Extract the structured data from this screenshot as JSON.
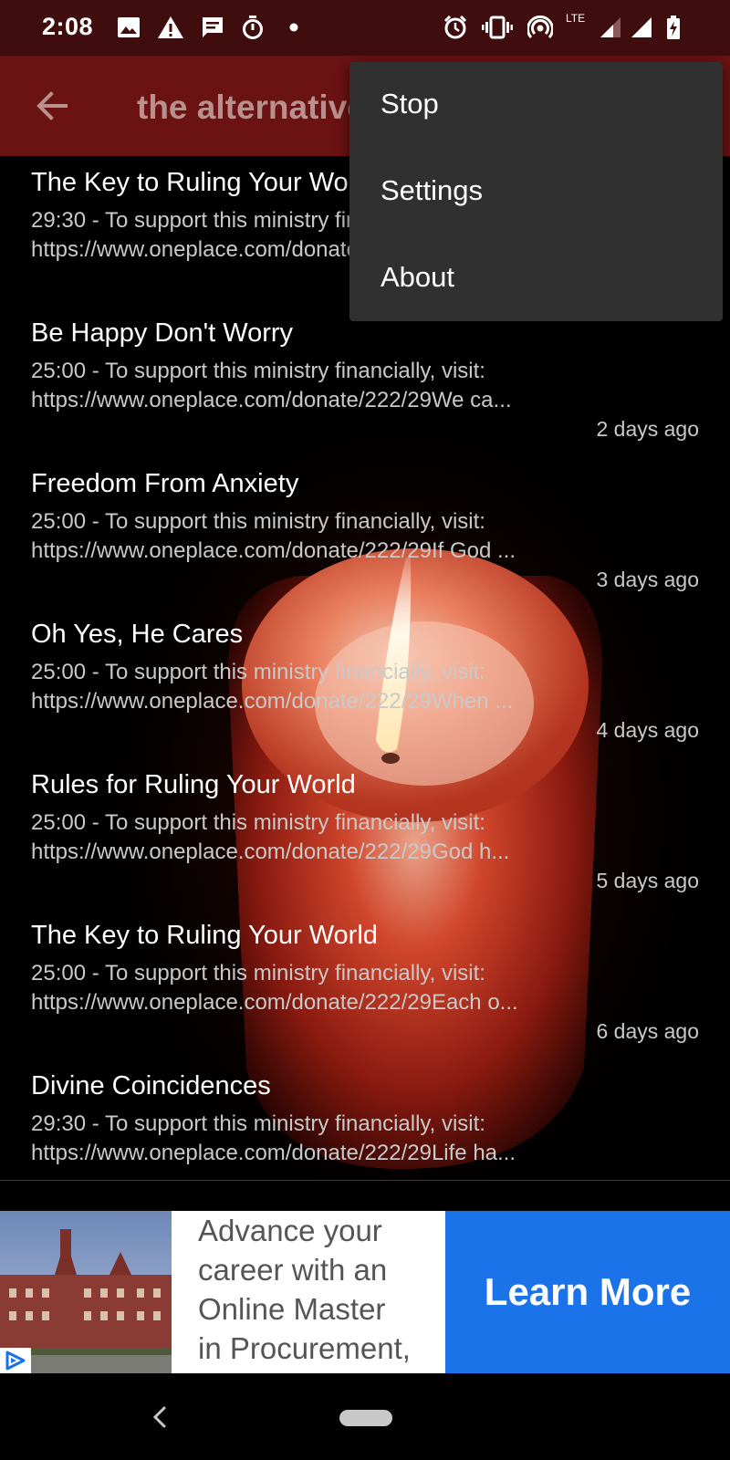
{
  "status_bar": {
    "time": "2:08",
    "network": "LTE",
    "icons": [
      "image-icon",
      "warning-icon",
      "message-icon",
      "timer-icon",
      "dot-icon",
      "alarm-icon",
      "vibrate-icon",
      "hotspot-icon",
      "signal-icon",
      "signal-icon",
      "battery-charging-icon"
    ]
  },
  "app_bar": {
    "title": "the alternative",
    "back_icon": "arrow-back-icon"
  },
  "menu": {
    "items": [
      {
        "label": "Stop"
      },
      {
        "label": "Settings"
      },
      {
        "label": "About"
      }
    ]
  },
  "episodes": [
    {
      "title": "The Key to Ruling Your World",
      "desc_line1": "29:30 - To support this ministry financially, visit:",
      "desc_line2": "https://www.oneplace.com/donate/222/29",
      "date": ""
    },
    {
      "title": "Be Happy Don't Worry",
      "desc_line1": "25:00 - To support this ministry financially, visit:",
      "desc_line2": "https://www.oneplace.com/donate/222/29We ca...",
      "date": "2 days ago"
    },
    {
      "title": "Freedom From Anxiety",
      "desc_line1": "25:00 - To support this ministry financially, visit:",
      "desc_line2": "https://www.oneplace.com/donate/222/29If God ...",
      "date": "3 days ago"
    },
    {
      "title": "Oh Yes, He Cares",
      "desc_line1": "25:00 - To support this ministry financially, visit:",
      "desc_line2": "https://www.oneplace.com/donate/222/29When ...",
      "date": "4 days ago"
    },
    {
      "title": "Rules for Ruling Your World",
      "desc_line1": "25:00 - To support this ministry financially, visit:",
      "desc_line2": "https://www.oneplace.com/donate/222/29God h...",
      "date": "5 days ago"
    },
    {
      "title": "The Key to Ruling Your World",
      "desc_line1": "25:00 - To support this ministry financially, visit:",
      "desc_line2": "https://www.oneplace.com/donate/222/29Each o...",
      "date": "6 days ago"
    },
    {
      "title": "Divine Coincidences",
      "desc_line1": "29:30 - To support this ministry financially, visit:",
      "desc_line2": "https://www.oneplace.com/donate/222/29Life ha...",
      "date": ""
    }
  ],
  "ad": {
    "text_lines": [
      "Advance your",
      "career with an",
      "Online Master",
      "in Procurement,"
    ],
    "button_label": "Learn More",
    "button_color": "#1a73e8",
    "adchoices_icon": "adchoices-icon"
  },
  "nav_bar": {
    "back_icon": "nav-back-icon",
    "home_icon": "home-pill-icon"
  },
  "colors": {
    "status_bar": "#3f0d0e",
    "app_bar": "#6b1212",
    "menu_bg": "#303030"
  }
}
